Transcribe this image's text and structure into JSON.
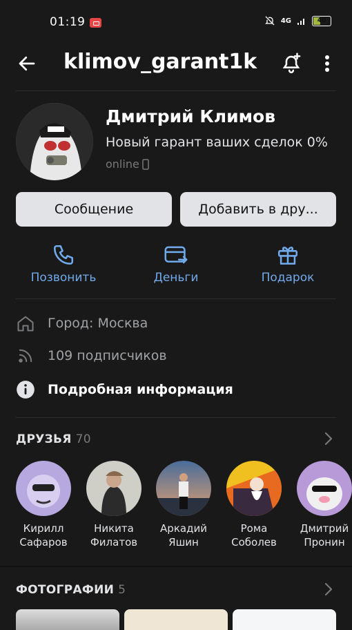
{
  "status_bar": {
    "time": "01:19",
    "network": "4G",
    "battery": "40"
  },
  "header": {
    "username": "klimov_garant1k"
  },
  "profile": {
    "name": "Дмитрий Климов",
    "status": "Новый гарант ваших сделок 0%",
    "online": "online"
  },
  "buttons": {
    "message": "Сообщение",
    "add_friend": "Добавить в дру..."
  },
  "actions": [
    {
      "label": "Позвонить",
      "icon": "phone-icon"
    },
    {
      "label": "Деньги",
      "icon": "money-icon"
    },
    {
      "label": "Подарок",
      "icon": "gift-icon"
    }
  ],
  "info": {
    "city": "Город: Москва",
    "followers": "109 подписчиков",
    "details": "Подробная информация"
  },
  "friends": {
    "title": "ДРУЗЬЯ",
    "count": "70",
    "items": [
      {
        "first": "Кирилл",
        "last": "Сафаров"
      },
      {
        "first": "Никита",
        "last": "Филатов"
      },
      {
        "first": "Аркадий",
        "last": "Яшин"
      },
      {
        "first": "Рома",
        "last": "Соболев"
      },
      {
        "first": "Дмитрий",
        "last": "Пронин"
      }
    ]
  },
  "photos": {
    "title": "ФОТОГРАФИИ",
    "count": "5"
  },
  "colors": {
    "background": "#19191a",
    "accent": "#71aaeb",
    "button": "#e1e3e6"
  }
}
